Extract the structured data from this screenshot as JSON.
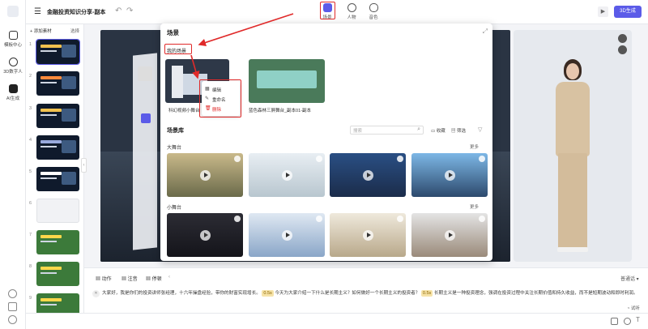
{
  "app": {
    "title": "金融投资知识分享-副本"
  },
  "rail": {
    "items": [
      {
        "label": "模板中心"
      },
      {
        "label": "3D数字人"
      },
      {
        "label": "AI生成"
      }
    ]
  },
  "topbar": {
    "tabs": [
      {
        "label": "场景"
      },
      {
        "label": "人物"
      },
      {
        "label": "音色"
      }
    ],
    "generate_label": "3D生成"
  },
  "slides": {
    "add_label": "+ 添加素材",
    "select_label": "选择",
    "numbers": [
      "1",
      "2",
      "3",
      "4",
      "5",
      "6",
      "7",
      "8",
      "9"
    ]
  },
  "popup": {
    "title": "场景",
    "my_tab": "我的场景",
    "my_scenes": [
      {
        "name": "科幻视频小舞台"
      },
      {
        "name": "蓝色森林三屏舞台_副本01-副本"
      }
    ],
    "context_menu": [
      "编辑",
      "重命名",
      "删除"
    ],
    "library_label": "场景库",
    "search_placeholder": "搜索",
    "favorite_label": "收藏",
    "filter_label": "筛选",
    "sections": [
      {
        "title": "大舞台",
        "more": "更多"
      },
      {
        "title": "小舞台",
        "more": "更多"
      }
    ]
  },
  "script": {
    "tabs": [
      "动作",
      "注音",
      "停顿"
    ],
    "lang": "普通话",
    "text_a": "大家好，我是你们的投资讲师张经理，十六年操盘经验，带你的财富实现增长。",
    "pause1": "0.5s",
    "text_b": "今天为大家介绍一下什么是长期主义？如何做好一个长期主义的投资者？",
    "pause2": "0.5s",
    "text_c": "长期主义是一种投资理念，强调在投资过程中关注长期价值和持久收益，而不是短期波动和即时利润。",
    "preview": "试听"
  },
  "colors": {
    "accent": "#5b5be8",
    "danger": "#e02a2a"
  }
}
